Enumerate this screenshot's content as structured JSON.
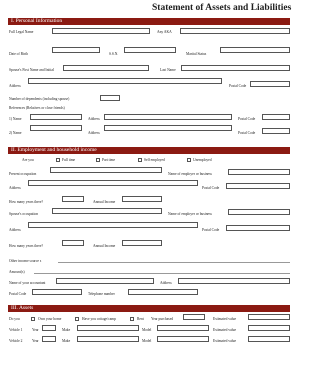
{
  "header": {
    "title": "Statement of Assets and Liabilities"
  },
  "sections": [
    {
      "label": "I. Personal Information"
    },
    {
      "label": "II. Employment and household income"
    },
    {
      "label": "III. Assets"
    }
  ],
  "personal": {
    "full_legal_name": "Full Legal Name",
    "any_aka": "Any AKA",
    "date_of_birth": "Date of Birth",
    "ssn": "S.S.N.",
    "marital_status": "Marital Status",
    "spouse_first_name": "Spouse's First Name and Initial",
    "last_name": "Last Name",
    "address": "Address",
    "postal_code": "Postal Code",
    "dependents": "Number of dependents (including spouse)",
    "references": "References (Relatives or close friends)",
    "ref_name_1": "1) Name",
    "ref_address_1": "Address",
    "ref_postal_1": "Postal Code",
    "ref_name_2": "2) Name",
    "ref_address_2": "Address",
    "ref_postal_2": "Postal Code"
  },
  "employment": {
    "are_you": "Are you",
    "options": [
      "Full time",
      "Part time",
      "Self employed",
      "Unemployed"
    ],
    "present_occupation": "Present occupation",
    "employer_name": "Name of employer or business",
    "address": "Address",
    "postal_code": "Postal Code",
    "years_there": "How many years there?",
    "annual_income": "Annual Income",
    "spouse_occupation": "Spouse's occupation",
    "spouse_employer_name": "Name of employer or business",
    "spouse_address": "Address",
    "spouse_postal_code": "Postal Code",
    "spouse_years_there": "How many years there?",
    "spouse_annual_income": "Annual Income",
    "other_income": "Other income source s",
    "amounts": "Amount(s)",
    "accountant_name": "Name of your accountant",
    "accountant_address": "Address",
    "accountant_postal": "Postal Code",
    "telephone": "Telephone number"
  },
  "assets": {
    "do_you": "Do you",
    "own_home": "Own your home",
    "have_cottage": "Have you cottage/camp",
    "rent": "Rent",
    "year_purchased": "Year purchased",
    "estimated_value": "Estimated value",
    "vehicle1": "Vehicle 1",
    "vehicle2": "Vehicle 2",
    "year": "Year",
    "make": "Make",
    "model": "Model",
    "vehicle_estimated_value": "Estimated value"
  }
}
